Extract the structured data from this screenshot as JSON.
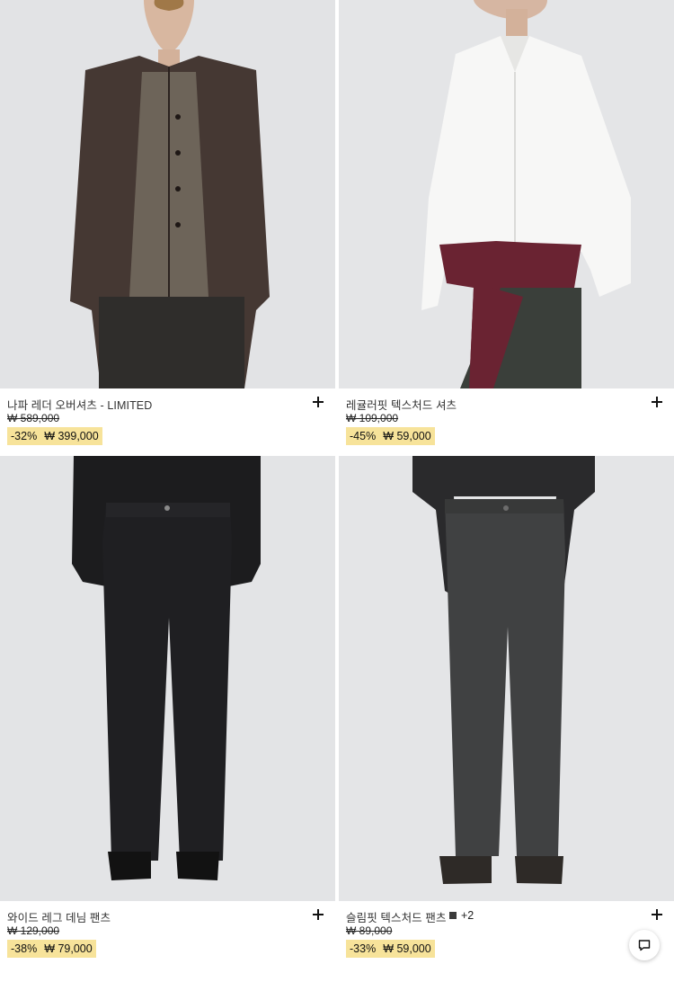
{
  "products": [
    {
      "name": "나파 레더 오버셔츠 - LIMITED",
      "original_price": "₩ 589,000",
      "discount": "-32%",
      "sale_price": "₩ 399,000"
    },
    {
      "name": "레귤러핏 텍스처드 셔츠",
      "original_price": "₩ 109,000",
      "discount": "-45%",
      "sale_price": "₩ 59,000"
    },
    {
      "name": "와이드 레그 데님 팬츠",
      "original_price": "₩ 129,000",
      "discount": "-38%",
      "sale_price": "₩ 79,000"
    },
    {
      "name": "슬림핏 텍스처드 팬츠",
      "original_price": "₩ 89,000",
      "discount": "-33%",
      "sale_price": "₩ 59,000",
      "more_colors": "+2"
    }
  ],
  "colors": {
    "discount_bg": "#f7e39a",
    "text": "#1a1a1a",
    "image_bg": "#e3e4e6"
  },
  "icons": {
    "add": "plus-icon",
    "chat": "chat-bubble-icon"
  }
}
